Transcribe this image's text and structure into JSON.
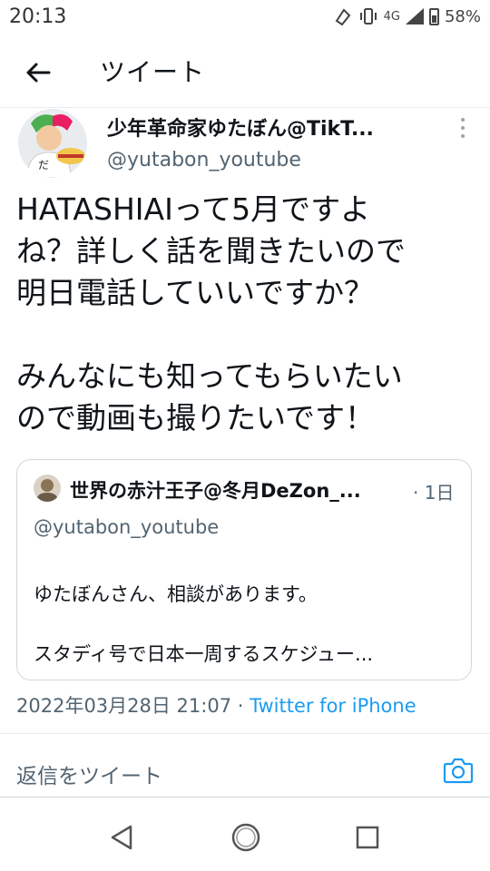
{
  "status_bar": {
    "time": "20:13",
    "network": "4G",
    "battery": "58%",
    "icons": [
      "nfc-icon",
      "vibrate-icon",
      "signal-icon",
      "battery-icon"
    ]
  },
  "header": {
    "title": "ツイート",
    "back_icon": "arrow-left-icon"
  },
  "tweet": {
    "author_name": "少年革命家ゆたぼん@TikT...",
    "author_handle": "@yutabon_youtube",
    "body": "HATASHIAIって5月ですよ\nね？詳しく話を聞きたいので\n明日電話していいですか？\n\nみんなにも知ってもらいたい\nので動画も撮りたいです！",
    "timestamp": "2022年03月28日 21:07",
    "separator": " · ",
    "source": "Twitter for iPhone"
  },
  "quote": {
    "author_name": "世界の赤汁王子@冬月DeZon_...",
    "time": "· 1日",
    "handle": "@yutabon_youtube",
    "line1": "ゆたぼんさん、相談があります。",
    "line2": "スタディ号で日本一周するスケジュー..."
  },
  "reply": {
    "placeholder": "返信をツイート",
    "camera_icon": "camera-icon"
  },
  "colors": {
    "accent": "#1d9bf0",
    "text": "#0f1419",
    "secondary": "#536471",
    "border": "#cfd9de"
  }
}
